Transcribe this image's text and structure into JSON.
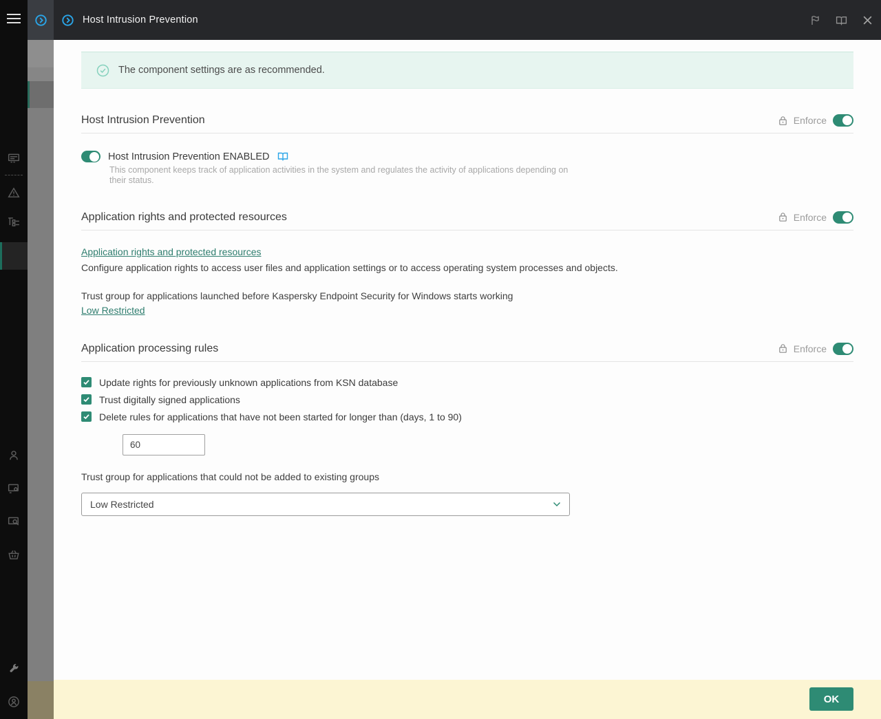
{
  "header": {
    "title": "Host Intrusion Prevention",
    "icons": [
      "app-tab-chevron-circle-icon",
      "chevron-circle-icon",
      "flag-icon",
      "open-book-icon",
      "close-icon"
    ]
  },
  "sidebar_icons": [
    "hamburger-menu-icon",
    "reports-icon",
    "warning-triangle-icon",
    "tree-structure-icon",
    "selected-nav-item",
    "user-icon",
    "device-settings-icon",
    "device-search-icon",
    "basket-icon",
    "wrench-icon",
    "account-icon"
  ],
  "banner": {
    "icon": "check-circle-icon",
    "message": "The component settings are as recommended."
  },
  "controls": {
    "enforce_label": "Enforce"
  },
  "sections": {
    "hips": {
      "title": "Host Intrusion Prevention",
      "toggle_label": "Host Intrusion Prevention ENABLED",
      "toggle_state": "on",
      "description": "This component keeps track of application activities in the system and regulates the activity of applications depending on their status."
    },
    "rights": {
      "title": "Application rights and protected resources",
      "link": "Application rights and protected resources",
      "description": "Configure application rights to access user files and application settings or to access operating system processes and objects.",
      "trust_group_label": "Trust group for applications launched before Kaspersky Endpoint Security for Windows starts working",
      "trust_group_link": "Low Restricted"
    },
    "processing": {
      "title": "Application processing rules",
      "checkboxes": [
        "Update rights for previously unknown applications from KSN database",
        "Trust digitally signed applications",
        "Delete rules for applications that have not been started for longer than (days, 1 to 90)"
      ],
      "checkbox_states": [
        true,
        true,
        true
      ],
      "days_value": "60",
      "trust_group_label": "Trust group for applications that could not be added to existing groups",
      "trust_group_value": "Low Restricted"
    }
  },
  "footer": {
    "ok_label": "OK"
  },
  "colors": {
    "accent_teal": "#2E8B74",
    "link_teal": "#2E7D6E",
    "brand_blue": "#2AA5E8",
    "banner_bg": "#E7F5F0",
    "footer_bg": "#FCF5D3",
    "header_bg": "#26272A",
    "rail_bg": "#0D0D0D"
  }
}
